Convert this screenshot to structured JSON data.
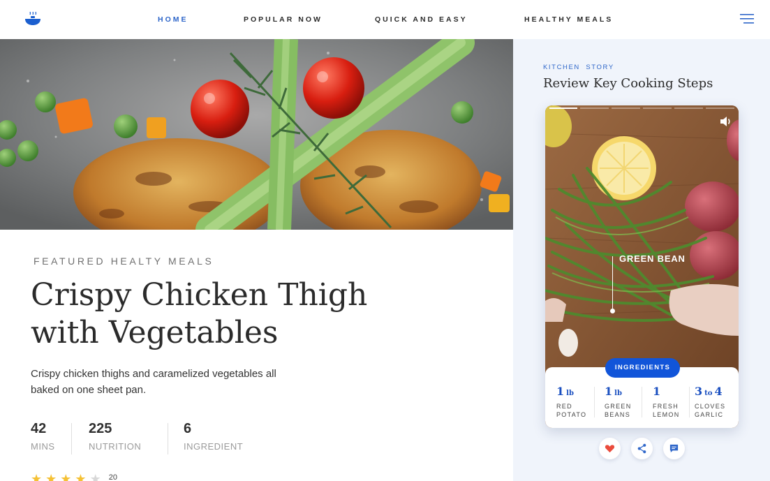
{
  "nav": {
    "items": [
      {
        "label": "HOME",
        "active": true
      },
      {
        "label": "POPULAR NOW",
        "active": false
      },
      {
        "label": "QUICK AND EASY",
        "active": false
      },
      {
        "label": "HEALTHY MEALS",
        "active": false
      }
    ],
    "logo_icon": "cooking-bowl-icon",
    "menu_icon": "hamburger-menu-icon"
  },
  "hero": {
    "image": "crispy chicken thigh with asparagus, tomatoes, peas and carrots"
  },
  "article": {
    "eyebrow": "FEATURED HEALTY MEALS",
    "title": "Crispy Chicken Thigh with Vegetables",
    "description": "Crispy chicken thighs and caramelized vegetables all baked on one sheet pan.",
    "stats": [
      {
        "value": "42",
        "label": "MINS"
      },
      {
        "value": "225",
        "label": "NUTRITION"
      },
      {
        "value": "6",
        "label": "INGREDIENT"
      }
    ],
    "rating": {
      "stars": 4,
      "max": 5,
      "count": "20"
    }
  },
  "story": {
    "eyebrow": "KITCHEN  STORY",
    "title": "Review Key Cooking Steps",
    "segments": 5,
    "segments_done": 1,
    "callout": "GREEN BEAN",
    "ingredients_button": "INGREDIENTS",
    "ingredients": [
      {
        "qty": "1",
        "unit": "lb",
        "name_line1": "RED",
        "name_line2": "POTATO"
      },
      {
        "qty": "1",
        "unit": "lb",
        "name_line1": "GREEN",
        "name_line2": "BEANS"
      },
      {
        "qty": "1",
        "unit": "",
        "name_line1": "FRESH",
        "name_line2": "LEMON"
      },
      {
        "qty": "3",
        "unit": "4",
        "to": "to",
        "name_line1": "CLOVES",
        "name_line2": "GARLIC"
      }
    ],
    "actions": [
      "heart-icon",
      "share-icon",
      "comment-icon"
    ]
  },
  "colors": {
    "accent": "#2e66c9",
    "button": "#1155d9",
    "heart": "#ea4b3c",
    "star": "#f5c134",
    "panel": "#f0f4fb"
  }
}
